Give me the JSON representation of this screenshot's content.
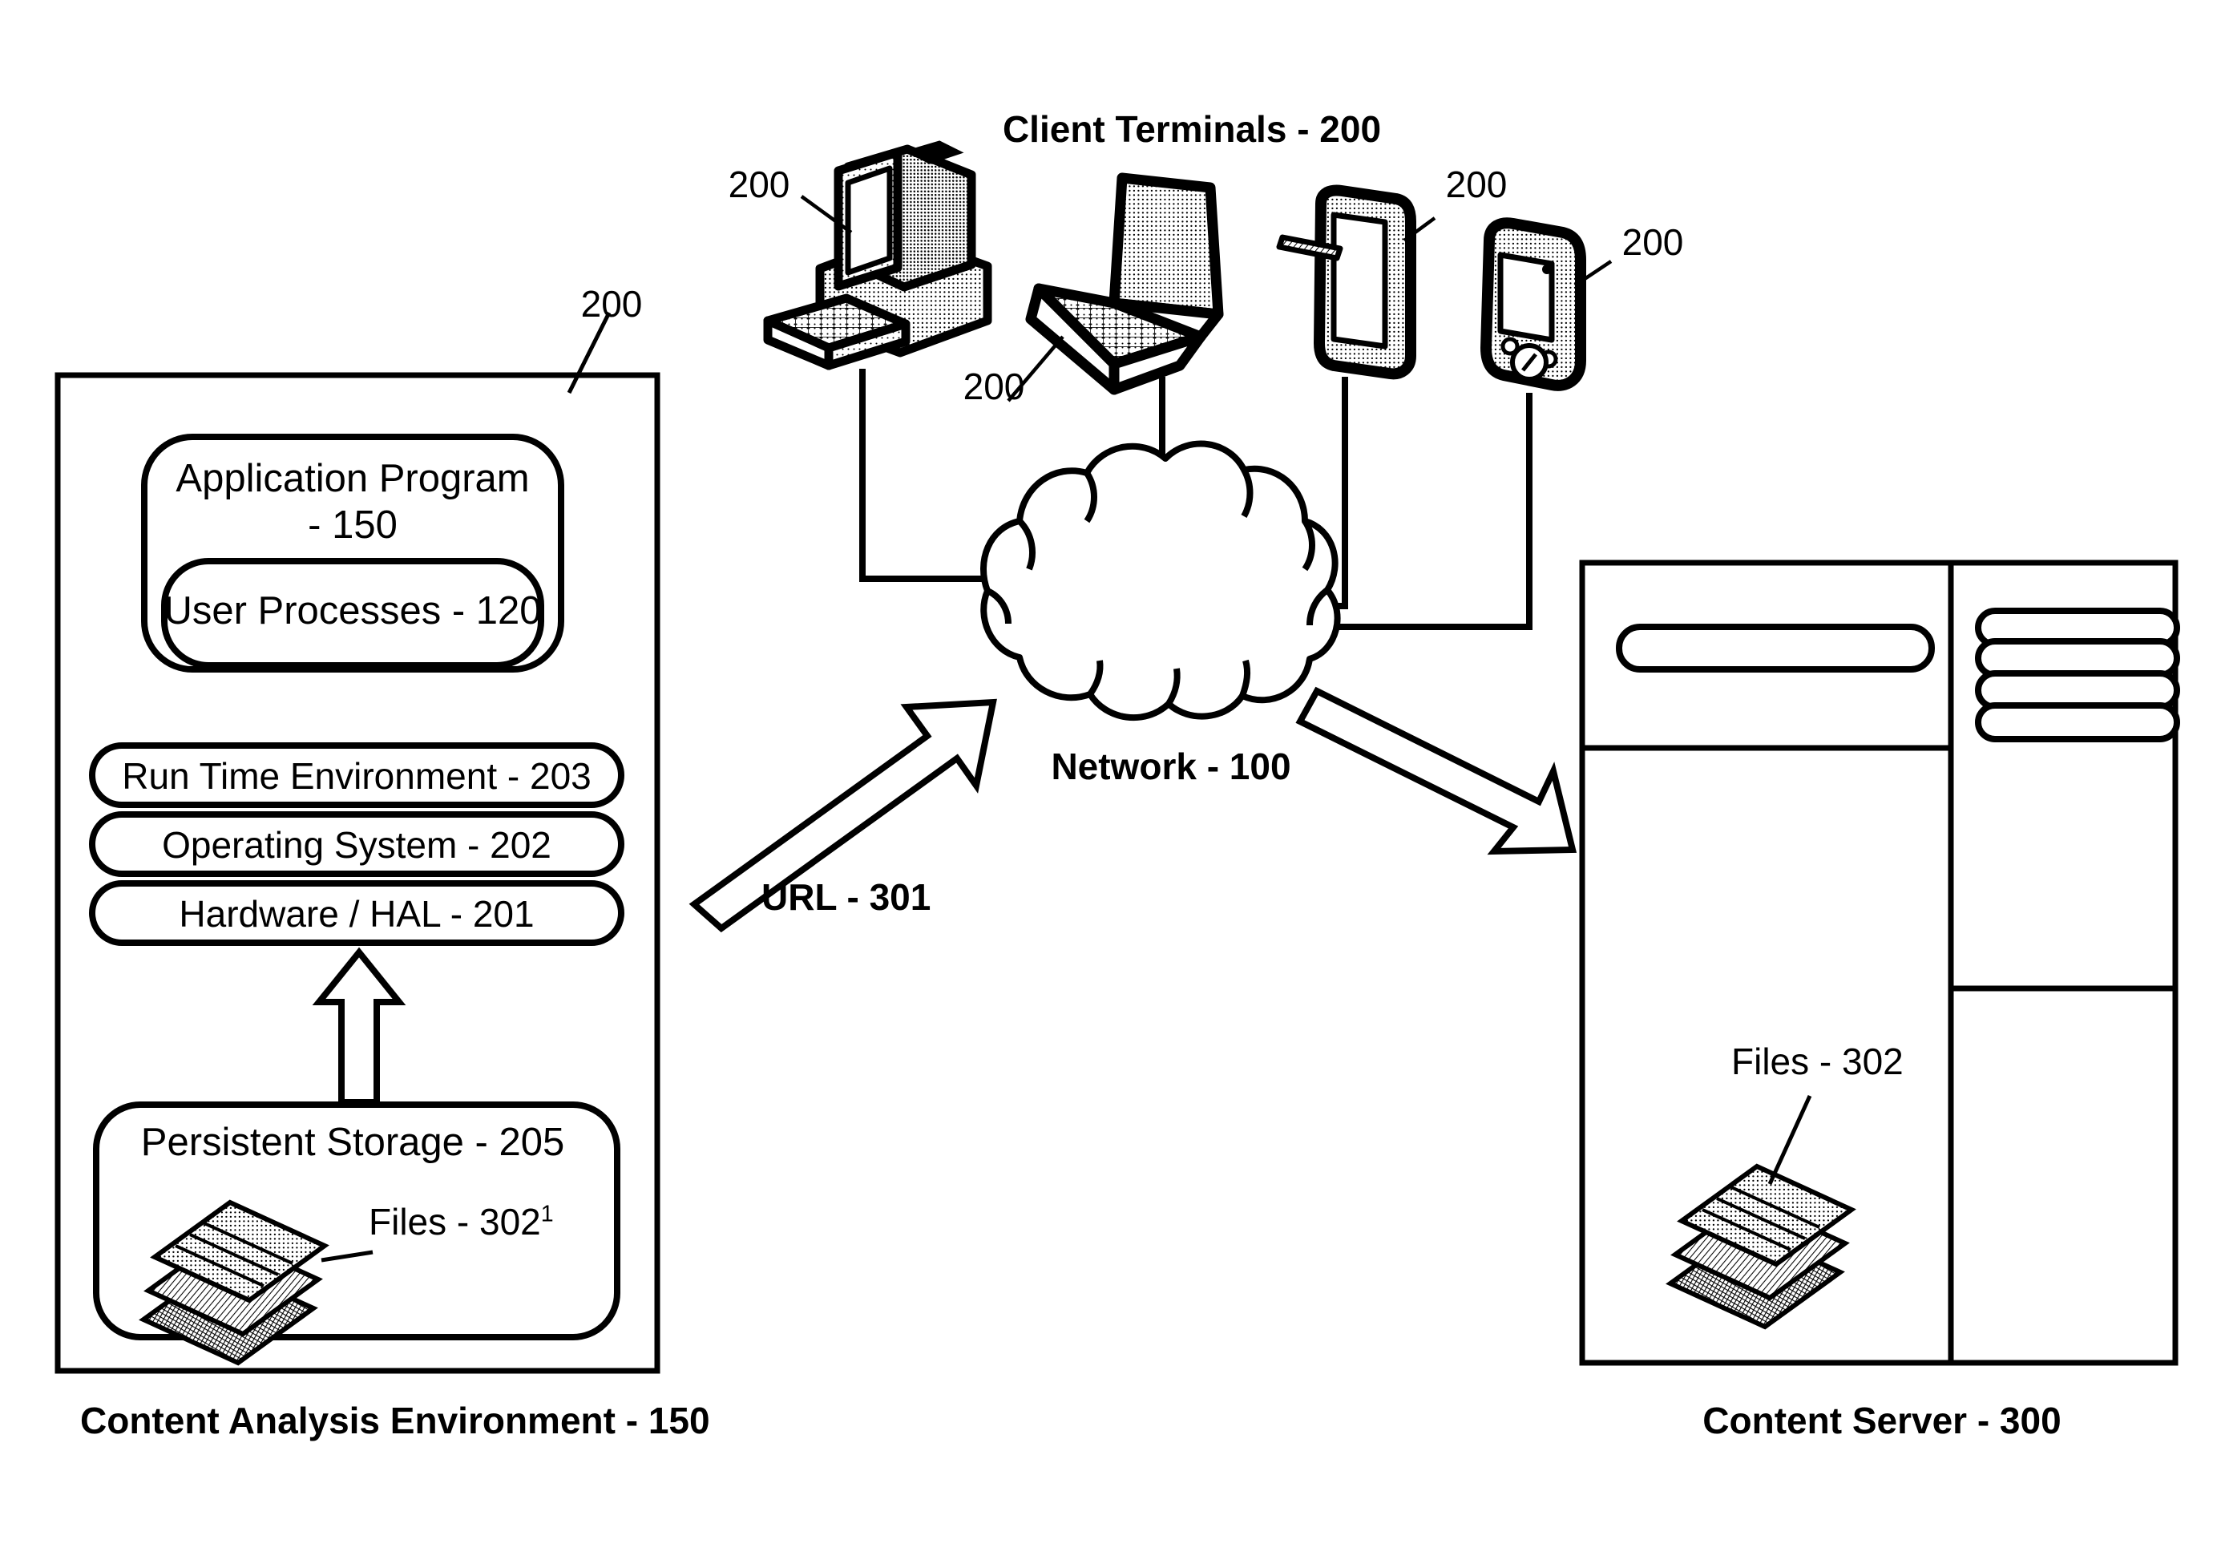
{
  "diagram": {
    "title_hidden": "",
    "figure_type": "patent-network-architecture"
  },
  "content_analysis_environment": {
    "ref_label": "200",
    "caption": "Content Analysis Environment - 150",
    "application_program": {
      "line1": "Application Program",
      "line2": "- 150",
      "user_processes": "User Processes - 120"
    },
    "stack": [
      {
        "label": "Run Time Environment - 203",
        "name": "run-time-environment"
      },
      {
        "label": "Operating System - 202",
        "name": "operating-system"
      },
      {
        "label": "Hardware / HAL - 201",
        "name": "hardware-hal"
      }
    ],
    "persistent_storage": {
      "label": "Persistent Storage - 205",
      "files_label": "Files - 302",
      "files_superscript": "1"
    }
  },
  "client_terminals": {
    "title": "Client Terminals - 200",
    "devices": [
      {
        "name": "desktop-computer",
        "ref": "200"
      },
      {
        "name": "laptop-computer",
        "ref": "200"
      },
      {
        "name": "tablet-device",
        "ref": "200"
      },
      {
        "name": "pda-smartphone",
        "ref": "200"
      }
    ]
  },
  "network": {
    "label": "Network - 100"
  },
  "url_arrow": {
    "label": "URL - 301"
  },
  "content_server": {
    "caption": "Content Server - 300",
    "files_label": "Files - 302",
    "drive_slots_left": 1,
    "drive_slots_right": 4
  },
  "colors": {
    "stroke": "#000000",
    "background": "#ffffff",
    "halftone": "#000000"
  }
}
